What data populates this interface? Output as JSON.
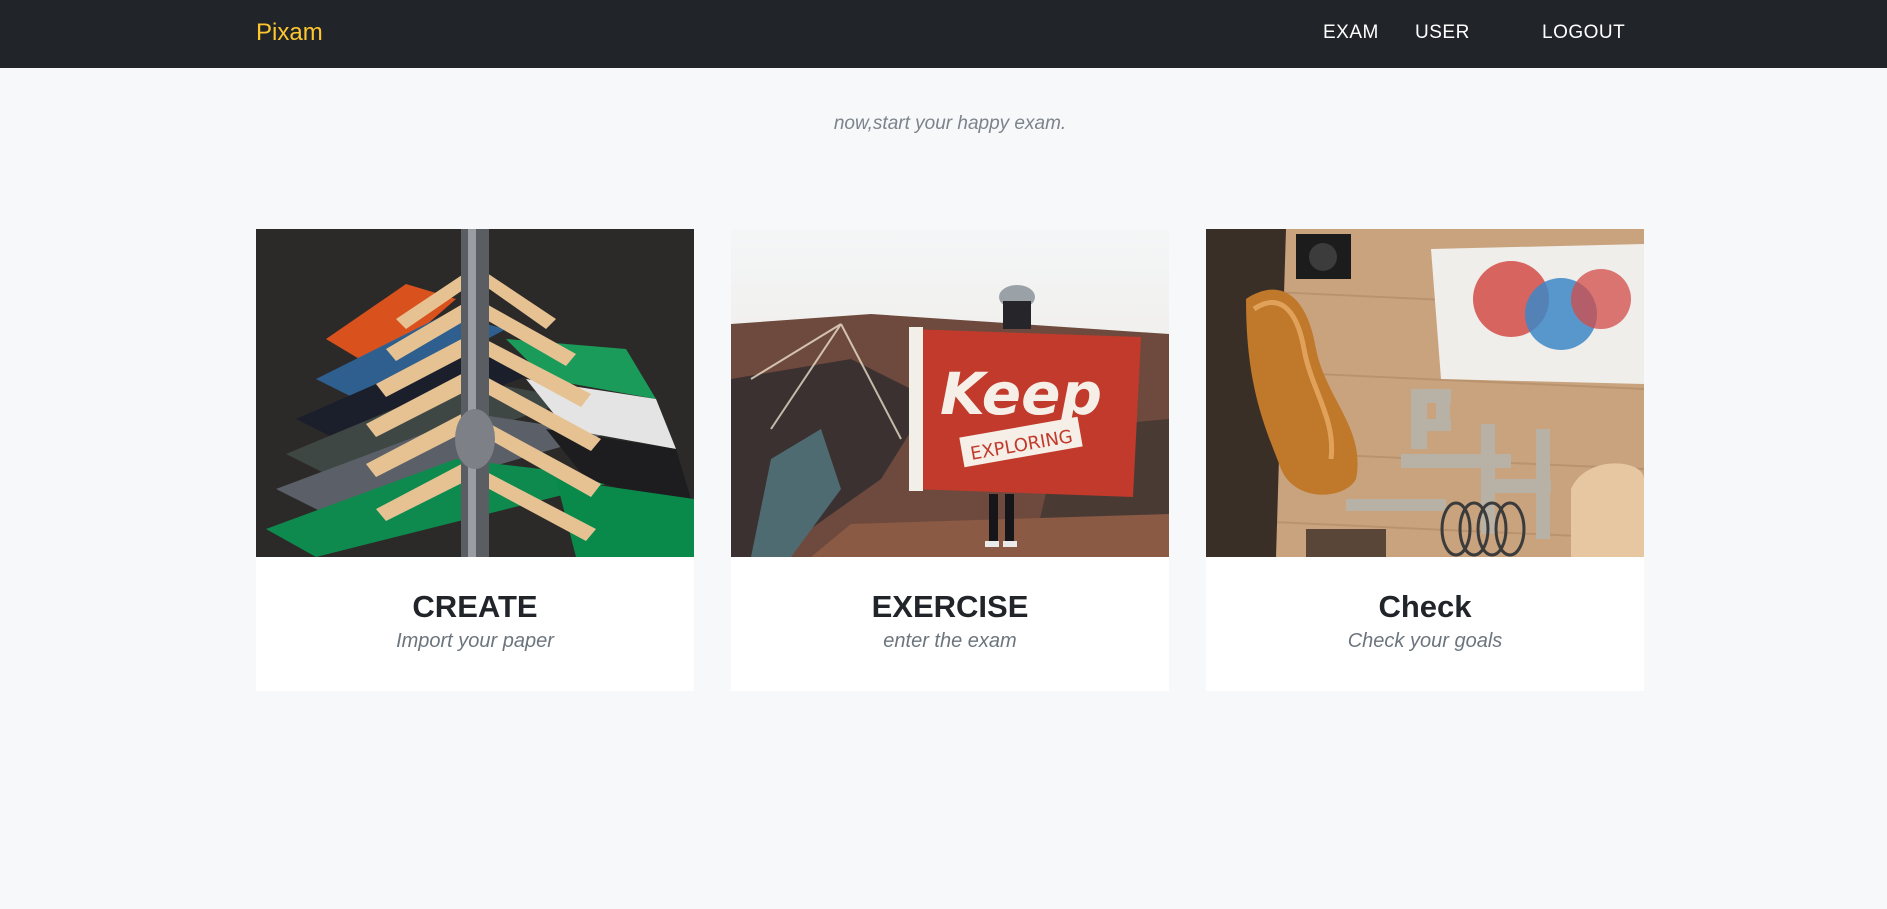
{
  "navbar": {
    "brand": "Pixam",
    "links": [
      {
        "label": "EXAM"
      },
      {
        "label": "USER"
      },
      {
        "label": "LOGOUT"
      }
    ]
  },
  "tagline": "now,start your happy exam.",
  "cards": [
    {
      "title": "CREATE",
      "subtitle": "Import your paper",
      "image": "clothes-rack-photo"
    },
    {
      "title": "EXERCISE",
      "subtitle": "enter the exam",
      "image": "keep-exploring-flag-photo",
      "image_text": [
        "Keep",
        "EXPLORING"
      ]
    },
    {
      "title": "Check",
      "subtitle": "Check your goals",
      "image": "craft-letters-photo"
    }
  ],
  "colors": {
    "navbar_bg": "#212429",
    "brand": "#fec72e",
    "page_bg": "#f7f8fa",
    "card_bg": "#ffffff",
    "title": "#212429",
    "muted": "#6c757d"
  }
}
